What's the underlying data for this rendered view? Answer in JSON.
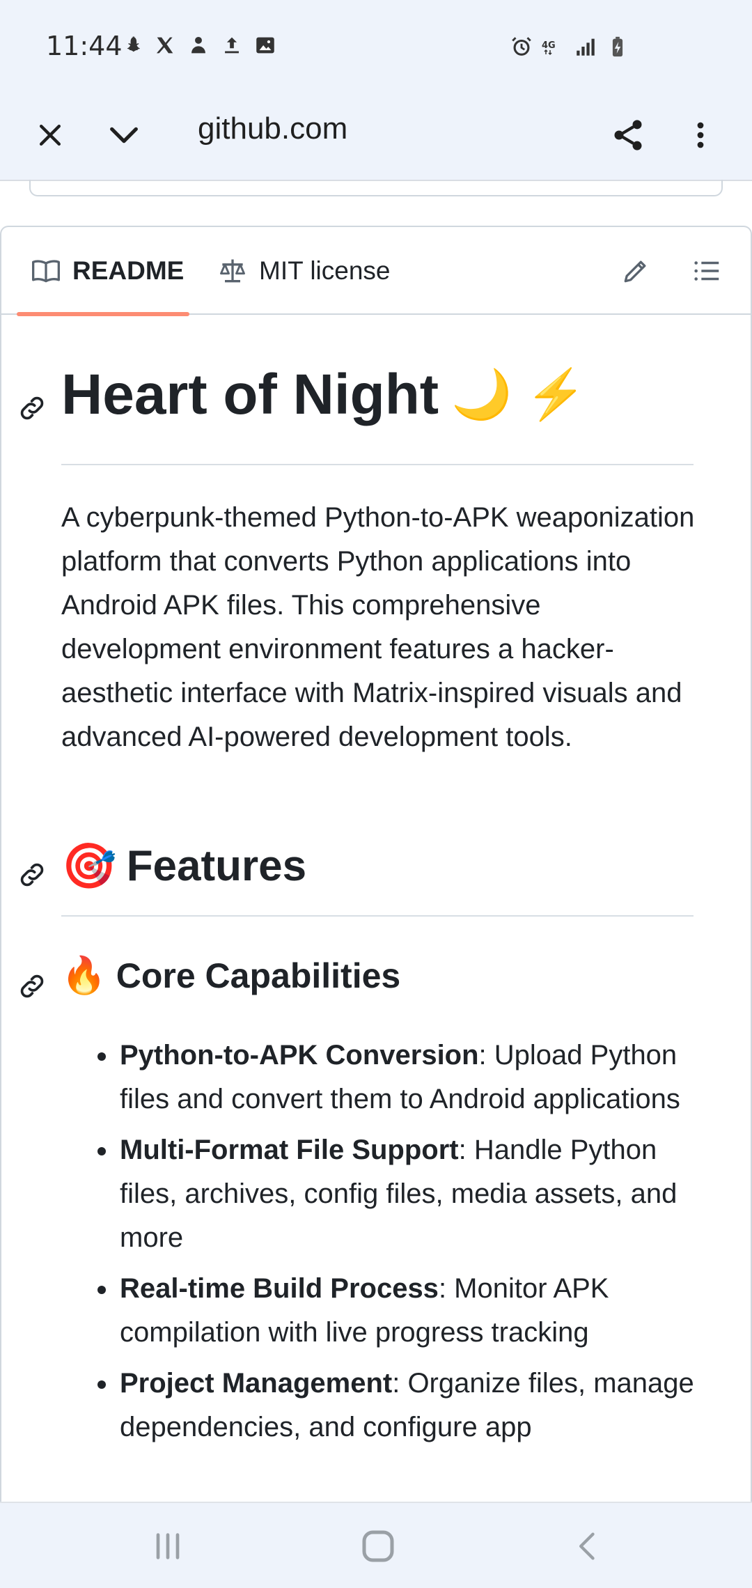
{
  "status_bar": {
    "time": "11:44",
    "left_icons": [
      "snapchat-icon",
      "x-icon",
      "person-icon",
      "upload-icon",
      "image-icon"
    ],
    "right_icons": [
      "alarm-icon",
      "4g-icon",
      "signal-icon",
      "battery-icon"
    ],
    "network": "4G"
  },
  "browser": {
    "url": "github.com",
    "close_icon": "close-icon",
    "collapse_icon": "chevron-down-icon",
    "share_icon": "share-icon",
    "menu_icon": "more-vert-icon"
  },
  "readme_tabs": {
    "readme_label": "README",
    "license_label": "MIT license",
    "accent_color": "#fd8c73"
  },
  "readme": {
    "title": "Heart of Night",
    "title_emoji": "🌙 ⚡",
    "intro": "A cyberpunk-themed Python-to-APK weaponization platform that converts Python applications into Android APK files. This comprehensive development environment features a hacker-aesthetic interface with Matrix-inspired visuals and advanced AI-powered development tools.",
    "features_heading": "Features",
    "features_emoji": "🎯",
    "core_heading": "Core Capabilities",
    "core_emoji": "🔥",
    "bullets": [
      {
        "term": "Python-to-APK Conversion",
        "text": ": Upload Python files and convert them to Android applications"
      },
      {
        "term": "Multi-Format File Support",
        "text": ": Handle Python files, archives, config files, media assets, and more"
      },
      {
        "term": "Real-time Build Process",
        "text": ": Monitor APK compilation with live progress tracking"
      },
      {
        "term": "Project Management",
        "text": ": Organize files, manage dependencies, and configure app"
      }
    ]
  },
  "nav_bar": {
    "icons": [
      "recents-icon",
      "home-icon",
      "back-icon"
    ]
  }
}
